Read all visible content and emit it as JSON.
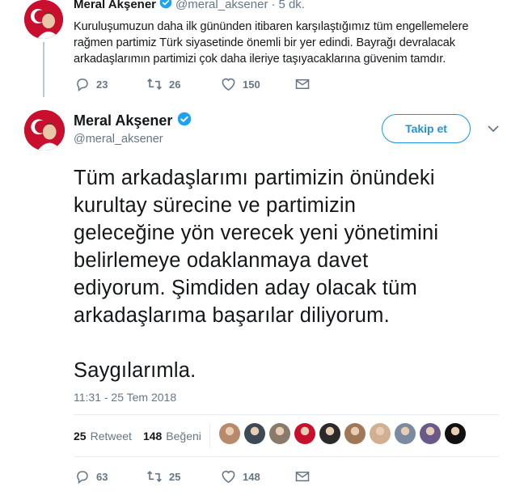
{
  "first_tweet": {
    "name": "Meral Akşener",
    "handle": "@meral_aksener",
    "separator": "·",
    "time": "5 dk.",
    "text_lines": [
      "Kuruluşumuzun daha ilk gününden itibaren karşılaştığımız tüm engellemelere",
      "rağmen partimiz Türk siyasetinde önemli bir yer edindi. Bayrağı devralacak",
      "arkadaşlarımın partimizi çok daha ileriye taşıyacaklarına güvenim tamdır."
    ],
    "replies": "23",
    "retweets": "26",
    "likes": "150"
  },
  "main_tweet": {
    "name": "Meral Akşener",
    "handle": "@meral_aksener",
    "follow_label": "Takip et",
    "text_lines": [
      "Tüm arkadaşlarımı partimizin önündeki",
      "kurultay sürecine ve partimizin",
      "geleceğine yön verecek yeni yönetimini",
      "belirlemeye odaklanmaya davet",
      "ediyorum. Şimdiden aday olacak tüm",
      "arkadaşlarıma başarılar diliyorum.",
      "",
      "Saygılarımla."
    ],
    "timestamp": "11:31 - 25 Tem 2018",
    "retweet_count": "25",
    "retweet_label": "Retweet",
    "like_count": "148",
    "like_label": "Beğeni",
    "replies": "63",
    "retweets": "25",
    "likes": "148",
    "liker_colors": [
      "#b68a6a",
      "#3d4a55",
      "#8a7a6a",
      "#c8102e",
      "#2a2a2a",
      "#a07858",
      "#d0b090",
      "#7a8aa0",
      "#6a5a8a",
      "#111111"
    ]
  },
  "colors": {
    "accent": "#1b95e0",
    "muted": "#657786",
    "verified": "#1da1f2"
  }
}
